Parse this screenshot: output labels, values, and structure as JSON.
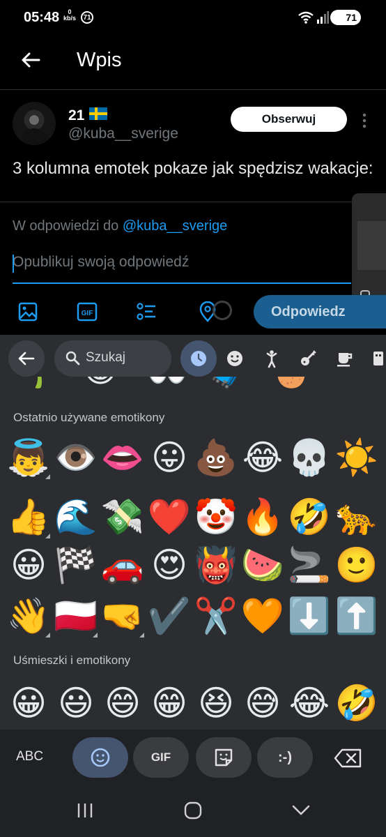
{
  "status_bar": {
    "time": "05:48",
    "net_speed_value": "0",
    "net_speed_unit": "kb/s",
    "notification_count": "71",
    "battery": "71"
  },
  "header": {
    "title": "Wpis"
  },
  "post": {
    "user_name": "21",
    "handle": "@kuba__sverige",
    "follow_label": "Obserwuj",
    "text": "3 kolumna emotek pokaze jak spędzisz wakacje:"
  },
  "reply": {
    "replying_prefix": "W odpowiedzi do",
    "replying_mention": "@kuba__sverige",
    "placeholder": "Opublikuj swoją odpowiedź",
    "submit_label": "Odpowiedz"
  },
  "toolbar": {
    "icons": [
      "image-icon",
      "gif-icon",
      "poll-icon",
      "location-icon"
    ]
  },
  "keyboard": {
    "search_placeholder": "Szukaj",
    "categories": [
      "recent-icon",
      "smiley-icon",
      "people-icon",
      "activity-icon",
      "food-icon",
      "travel-icon"
    ],
    "recent_title": "Ostatnio używane emotikony",
    "smileys_title": "Uśmieszki i emotikony",
    "recent_emojis": [
      "👼",
      "👁️",
      "👄",
      "😛",
      "💩",
      "😂",
      "💀",
      "☀️",
      "👍",
      "🌊",
      "💸",
      "❤️",
      "🤡",
      "🔥",
      "🤣",
      "🐆",
      "😀",
      "🏁",
      "🚗",
      "😍",
      "👹",
      "🍉",
      "🚬",
      "🙂",
      "👋",
      "🇵🇱",
      "🤜",
      "✔️",
      "✂️",
      "🧡",
      "⬇️",
      "⬆️"
    ],
    "smiley_emojis": [
      "😀",
      "😃",
      "😄",
      "😁",
      "😆",
      "😅",
      "😂",
      "🤣"
    ],
    "abc_label": "ABC",
    "gif_label": "GIF",
    "emoticon_label": ":-)"
  }
}
